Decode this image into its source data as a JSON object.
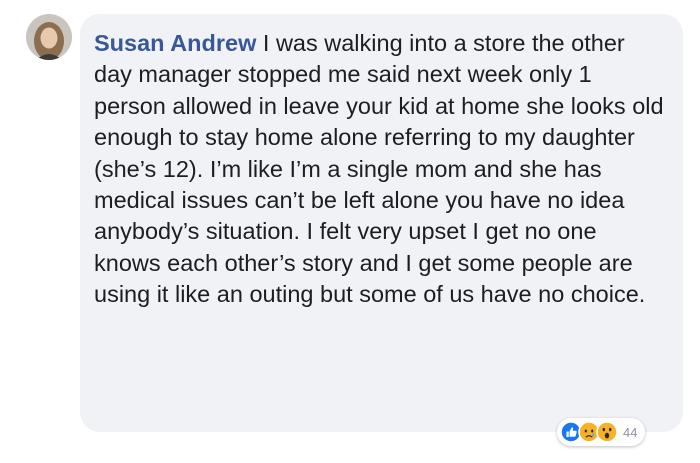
{
  "comment": {
    "author": "Susan Andrew",
    "text": "I was walking into a store the other day manager stopped me said next week only 1 person allowed in leave your kid at home she looks old enough to stay home alone referring to my daughter (she’s 12). I’m like I’m a single mom and she has medical issues can’t be left alone you have no idea anybody’s situation. I felt very upset I get no one knows each other’s story and I get some people are using it like an outing but some of us have no choice."
  },
  "reactions": {
    "icons": [
      "like-icon",
      "sad-icon",
      "wow-icon"
    ],
    "count": "44"
  },
  "colors": {
    "author": "#385898",
    "bubble": "#f0f2f5",
    "text": "#1c1e21",
    "like": "#1877f2",
    "emoji": "#f7b125"
  }
}
